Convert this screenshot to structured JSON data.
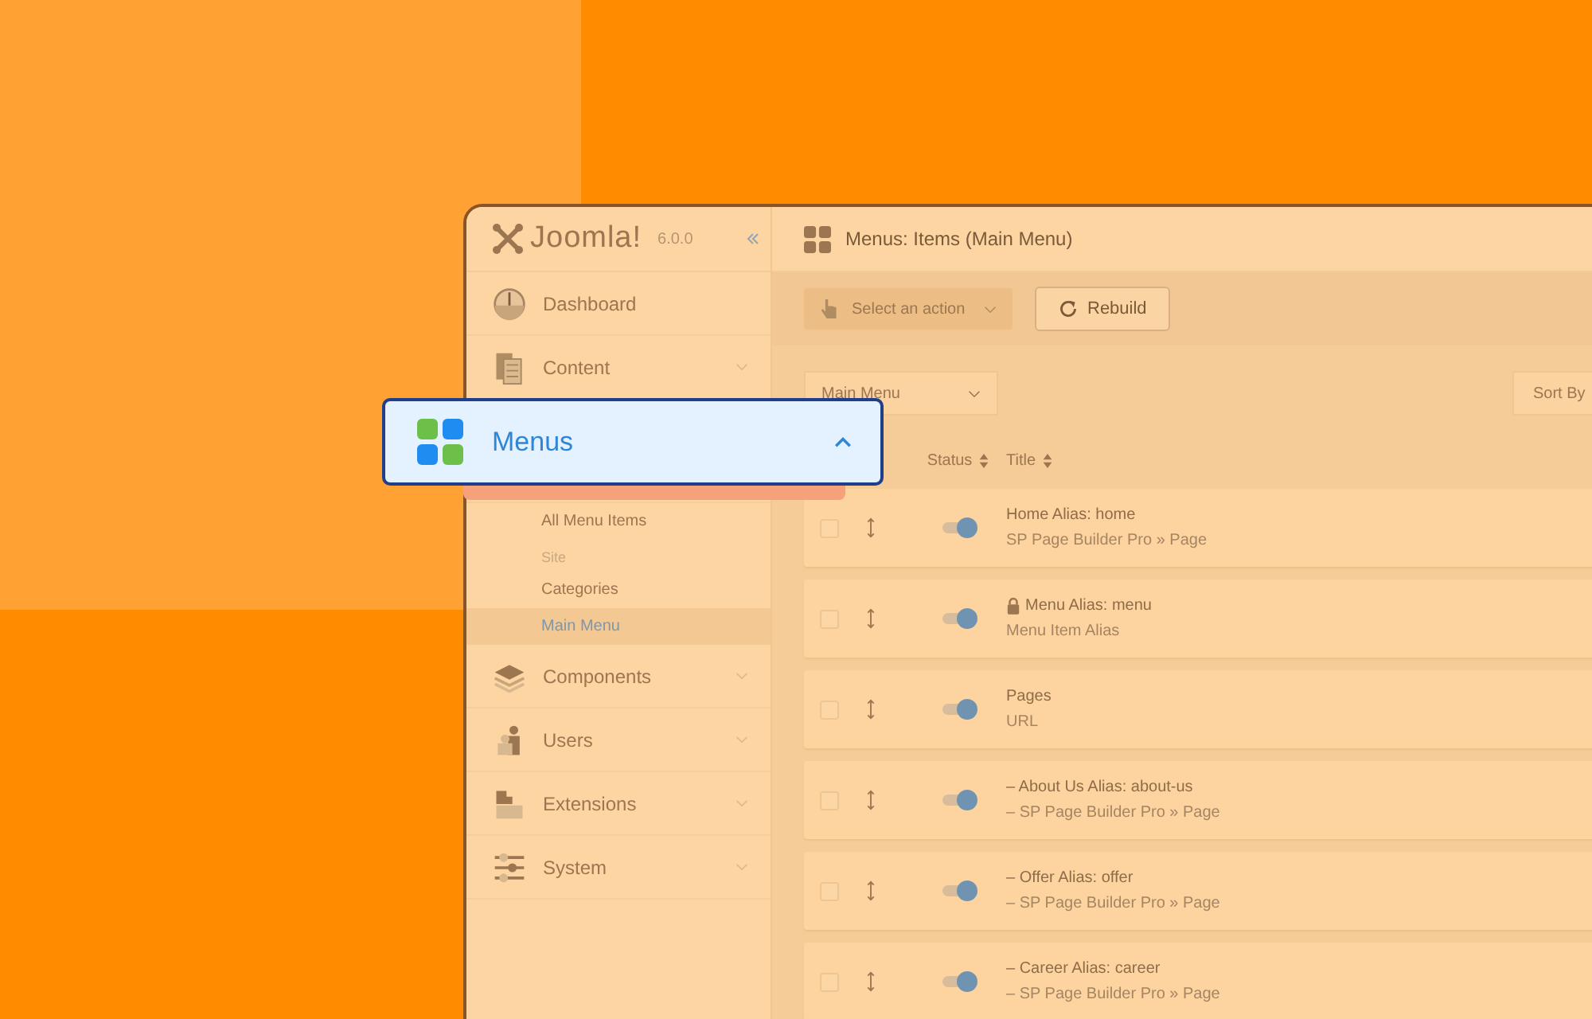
{
  "brand": {
    "name": "Joomla!",
    "version": "6.0.0"
  },
  "header": {
    "title": "Menus: Items (Main Menu)"
  },
  "sidebar": {
    "items": [
      {
        "kind": "main",
        "label": "Dashboard",
        "chevron": false,
        "selected": false
      },
      {
        "kind": "main",
        "label": "Content",
        "chevron": true,
        "selected": false
      },
      {
        "kind": "hidden"
      },
      {
        "kind": "sub",
        "label": "All Menu Items",
        "selected": false
      },
      {
        "kind": "group_label",
        "label": "Site"
      },
      {
        "kind": "sub",
        "label": "Categories",
        "selected": false
      },
      {
        "kind": "sub",
        "label": "Main Menu",
        "selected": true
      },
      {
        "kind": "main",
        "label": "Components",
        "chevron": true,
        "selected": false
      },
      {
        "kind": "main",
        "label": "Users",
        "chevron": true,
        "selected": false
      },
      {
        "kind": "main",
        "label": "Extensions",
        "chevron": true,
        "selected": false
      },
      {
        "kind": "main",
        "label": "System",
        "chevron": true,
        "selected": false
      }
    ]
  },
  "callout": {
    "label": "Menus",
    "expanded": true
  },
  "toolbar": {
    "action_select": {
      "label": "Select an action",
      "disabled": true
    },
    "rebuild": {
      "label": "Rebuild"
    }
  },
  "filters": {
    "menu_select": "Main Menu",
    "sort": "Sort By"
  },
  "table": {
    "columns": [
      "Status",
      "Title"
    ],
    "rows": [
      {
        "checked": false,
        "on": true,
        "locked": false,
        "title": "Home Alias: home",
        "subtitle": "SP Page Builder Pro » Page"
      },
      {
        "checked": false,
        "on": true,
        "locked": true,
        "title": "Menu Alias: menu",
        "subtitle": "Menu Item Alias"
      },
      {
        "checked": false,
        "on": true,
        "locked": false,
        "title": "Pages",
        "subtitle": "URL"
      },
      {
        "checked": false,
        "on": true,
        "locked": false,
        "title": "–  About Us Alias: about-us",
        "subtitle": "–  SP Page Builder Pro » Page"
      },
      {
        "checked": false,
        "on": true,
        "locked": false,
        "title": "–  Offer Alias: offer",
        "subtitle": "–  SP Page Builder Pro » Page"
      },
      {
        "checked": false,
        "on": true,
        "locked": false,
        "title": "–  Career Alias: career",
        "subtitle": "–  SP Page Builder Pro » Page"
      }
    ]
  }
}
